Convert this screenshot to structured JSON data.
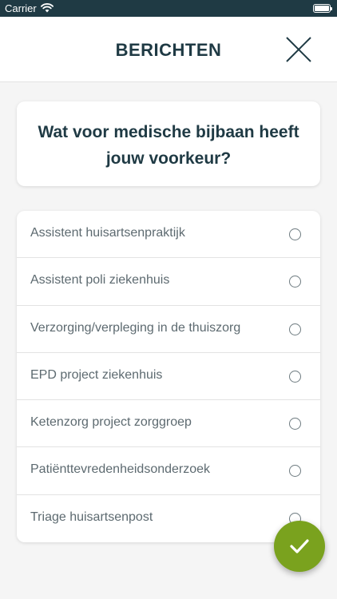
{
  "status_bar": {
    "carrier": "Carrier",
    "icons": [
      "wifi-icon",
      "battery-icon"
    ]
  },
  "header": {
    "title": "BERICHTEN",
    "close_icon": "close-icon"
  },
  "question": {
    "text": "Wat voor medische bijbaan heeft jouw voorkeur?"
  },
  "options": [
    {
      "label": "Assistent huisartsenpraktijk",
      "selected": false
    },
    {
      "label": "Assistent poli ziekenhuis",
      "selected": false
    },
    {
      "label": "Verzorging/verpleging in de thuiszorg",
      "selected": false
    },
    {
      "label": "EPD project ziekenhuis",
      "selected": false
    },
    {
      "label": "Ketenzorg project zorggroep",
      "selected": false
    },
    {
      "label": "Patiënttevredenheidsonderzoek",
      "selected": false
    },
    {
      "label": "Triage huisartsenpost",
      "selected": false
    }
  ],
  "submit_button": {
    "icon": "checkmark-icon"
  },
  "colors": {
    "header_text": "#1f3a44",
    "status_bar": "#1f3a44",
    "option_text": "#5d6a70",
    "accent_green": "#7aa21e",
    "background": "#f5f5f5"
  }
}
